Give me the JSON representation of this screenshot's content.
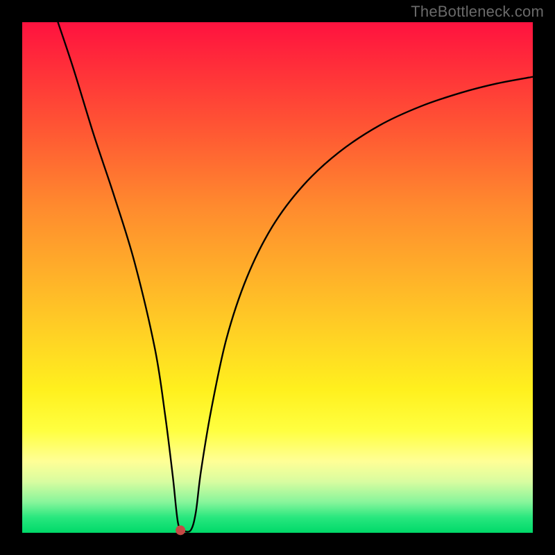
{
  "watermark": "TheBottleneck.com",
  "chart_data": {
    "type": "line",
    "title": "",
    "xlabel": "",
    "ylabel": "",
    "xlim": [
      0,
      100
    ],
    "ylim": [
      0,
      100
    ],
    "grid": false,
    "annotations": [
      "marker-dot"
    ],
    "series": [
      {
        "name": "bottleneck-curve",
        "x": [
          7,
          10,
          14,
          18,
          22,
          26,
          28,
          29.5,
          30.5,
          31.5,
          33,
          34,
          35,
          37,
          40,
          44,
          49,
          55,
          62,
          70,
          78,
          86,
          93,
          100
        ],
        "y": [
          100,
          91,
          78,
          66,
          53,
          36,
          23,
          11,
          2,
          0.5,
          0.5,
          4,
          12,
          24,
          38,
          50,
          60,
          68,
          74.5,
          79.8,
          83.5,
          86.2,
          88,
          89.3
        ]
      }
    ],
    "marker": {
      "x": 31,
      "y": 0.5
    },
    "background_gradient": {
      "top": "#ff123f",
      "middle": "#ffd424",
      "bottom": "#00d969"
    }
  }
}
